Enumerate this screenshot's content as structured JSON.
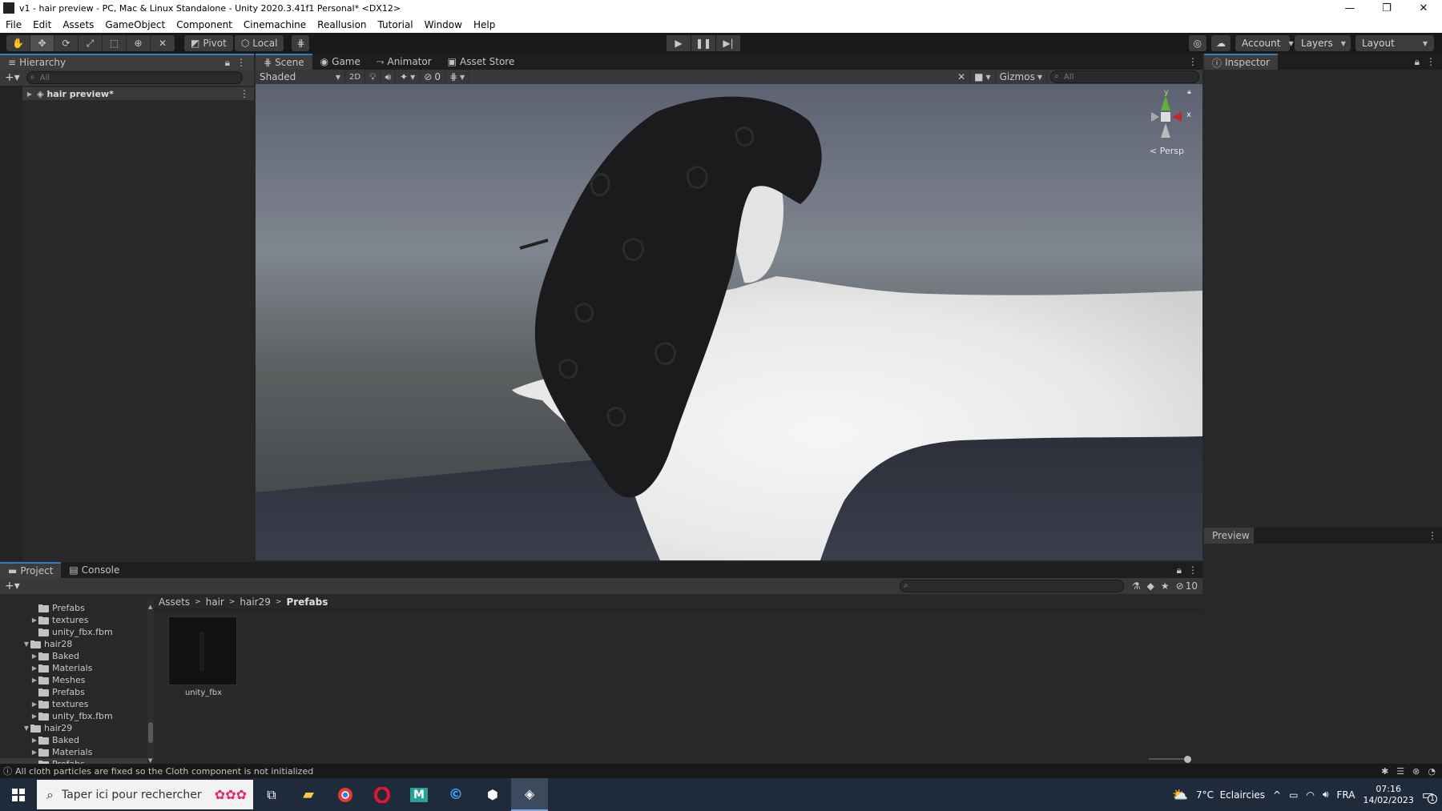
{
  "window": {
    "title": "v1 - hair preview - PC, Mac & Linux Standalone - Unity 2020.3.41f1 Personal* <DX12>",
    "minimize": "—",
    "maximize": "❐",
    "close": "✕"
  },
  "menu": {
    "items": [
      "File",
      "Edit",
      "Assets",
      "GameObject",
      "Component",
      "Cinemachine",
      "Reallusion",
      "Tutorial",
      "Window",
      "Help"
    ]
  },
  "toolbar": {
    "pivot_label": "Pivot",
    "local_label": "Local",
    "account_label": "Account",
    "layers_label": "Layers",
    "layout_label": "Layout"
  },
  "hierarchy": {
    "tab_label": "Hierarchy",
    "search_placeholder": "All",
    "scene_item": "hair preview*"
  },
  "scene_tabs": {
    "scene": "Scene",
    "game": "Game",
    "animator": "Animator",
    "asset_store": "Asset Store"
  },
  "scene_toolbar": {
    "shading_mode": "Shaded",
    "mode_2d": "2D",
    "hidden_count": "0",
    "gizmos_label": "Gizmos",
    "search_placeholder": "All"
  },
  "gizmo": {
    "axis_y": "y",
    "axis_x": "x",
    "projection": "< Persp"
  },
  "inspector": {
    "tab_label": "Inspector",
    "preview_label": "Preview"
  },
  "project": {
    "tab_project": "Project",
    "tab_console": "Console",
    "visible_count": "10",
    "breadcrumb": [
      "Assets",
      "hair",
      "hair29",
      "Prefabs"
    ],
    "tree": [
      {
        "label": "Prefabs",
        "indent": 2,
        "arrow": "",
        "cut": false
      },
      {
        "label": "textures",
        "indent": 2,
        "arrow": "▶"
      },
      {
        "label": "unity_fbx.fbm",
        "indent": 2,
        "arrow": ""
      },
      {
        "label": "hair28",
        "indent": 1,
        "arrow": "▼"
      },
      {
        "label": "Baked",
        "indent": 2,
        "arrow": "▶"
      },
      {
        "label": "Materials",
        "indent": 2,
        "arrow": "▶"
      },
      {
        "label": "Meshes",
        "indent": 2,
        "arrow": "▶"
      },
      {
        "label": "Prefabs",
        "indent": 2,
        "arrow": ""
      },
      {
        "label": "textures",
        "indent": 2,
        "arrow": "▶"
      },
      {
        "label": "unity_fbx.fbm",
        "indent": 2,
        "arrow": "▶"
      },
      {
        "label": "hair29",
        "indent": 1,
        "arrow": "▼"
      },
      {
        "label": "Baked",
        "indent": 2,
        "arrow": "▶"
      },
      {
        "label": "Materials",
        "indent": 2,
        "arrow": "▶"
      },
      {
        "label": "Prefabs",
        "indent": 2,
        "arrow": "",
        "selected": true
      }
    ],
    "asset": {
      "name": "unity_fbx"
    }
  },
  "status": {
    "message": "All cloth particles are fixed so the Cloth component is not initialized"
  },
  "taskbar": {
    "search_placeholder": "Taper ici pour rechercher",
    "weather": "7°C  Eclaircies",
    "language": "FRA",
    "time": "07:16",
    "date": "14/02/2023",
    "notification_count": "1"
  },
  "colors": {
    "accent": "#3a79bb",
    "panel": "#282828",
    "toolbar": "#191919",
    "taskbar": "#1f2b3a"
  }
}
